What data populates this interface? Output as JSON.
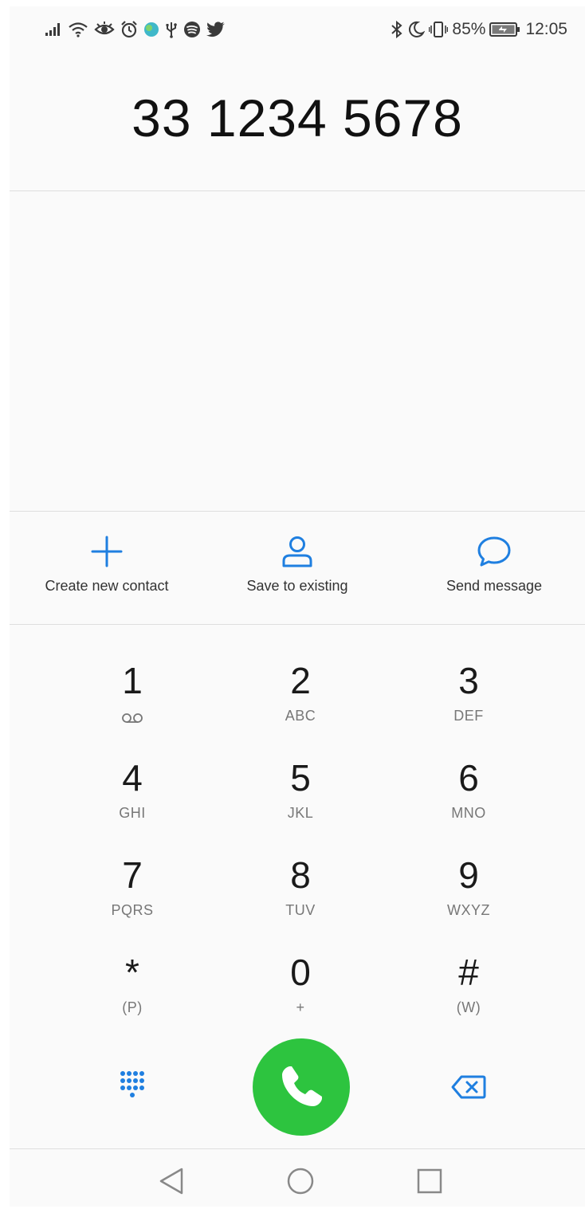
{
  "status_bar": {
    "battery_percent": "85%",
    "time": "12:05",
    "left_icons": [
      "signal-icon",
      "wifi-icon",
      "eye-icon",
      "alarm-icon",
      "app-icon",
      "usb-icon",
      "spotify-icon",
      "twitter-icon"
    ],
    "right_icons": [
      "bluetooth-icon",
      "moon-icon",
      "vibrate-icon",
      "battery-icon"
    ]
  },
  "dialer": {
    "number": "33 1234 5678"
  },
  "actions": [
    {
      "label": "Create new contact",
      "icon": "plus-icon"
    },
    {
      "label": "Save to existing",
      "icon": "person-icon"
    },
    {
      "label": "Send message",
      "icon": "message-icon"
    }
  ],
  "keypad": [
    {
      "digit": "1",
      "letters": ""
    },
    {
      "digit": "2",
      "letters": "ABC"
    },
    {
      "digit": "3",
      "letters": "DEF"
    },
    {
      "digit": "4",
      "letters": "GHI"
    },
    {
      "digit": "5",
      "letters": "JKL"
    },
    {
      "digit": "6",
      "letters": "MNO"
    },
    {
      "digit": "7",
      "letters": "PQRS"
    },
    {
      "digit": "8",
      "letters": "TUV"
    },
    {
      "digit": "9",
      "letters": "WXYZ"
    },
    {
      "digit": "*",
      "letters": "(P)"
    },
    {
      "digit": "0",
      "letters": "+"
    },
    {
      "digit": "#",
      "letters": "(W)"
    }
  ],
  "colors": {
    "accent": "#1f7fe0",
    "call_green": "#2dc43f",
    "background": "#fafafa"
  }
}
